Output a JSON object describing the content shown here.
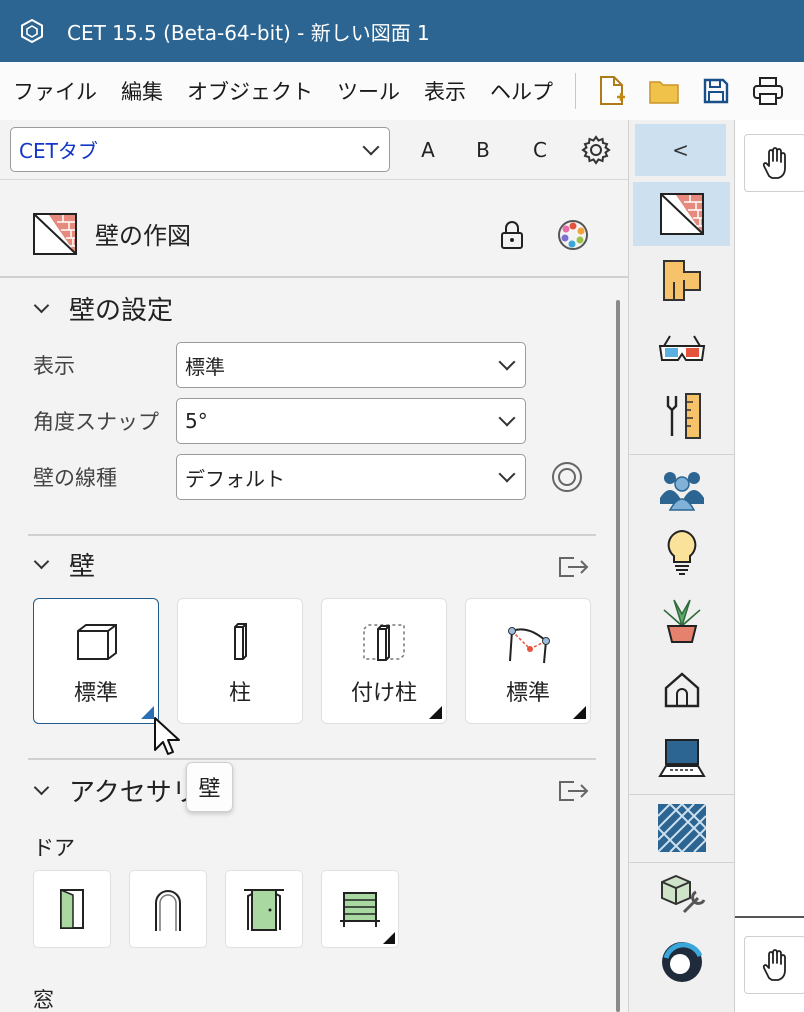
{
  "window": {
    "title": "CET 15.5 (Beta-64-bit) - 新しい図面 1"
  },
  "menu": [
    "ファイル",
    "編集",
    "オブジェクト",
    "ツール",
    "表示",
    "ヘルプ"
  ],
  "toolbar": {
    "icons": [
      "new-document-icon",
      "open-folder-icon",
      "save-icon",
      "print-icon"
    ]
  },
  "tabs": {
    "selected": "CETタブ",
    "letters": [
      "A",
      "B",
      "C"
    ],
    "collapse_glyph": "<"
  },
  "panel": {
    "title": "壁の作図"
  },
  "wall_settings": {
    "header": "壁の設定",
    "fields": [
      {
        "label": "表示",
        "value": "標準"
      },
      {
        "label": "角度スナップ",
        "value": "5°"
      },
      {
        "label": "壁の線種",
        "value": "デフォルト"
      }
    ]
  },
  "walls": {
    "header": "壁",
    "tiles": [
      {
        "label": "標準",
        "icon": "wall-block-icon",
        "selected": true
      },
      {
        "label": "柱",
        "icon": "column-icon",
        "selected": false
      },
      {
        "label": "付け柱",
        "icon": "attached-column-icon",
        "selected": false
      },
      {
        "label": "標準",
        "icon": "curved-wall-icon",
        "selected": false
      }
    ]
  },
  "accessories": {
    "header": "アクセサリ",
    "doors_label": "ドア",
    "door_icons": [
      "door-icon",
      "opening-arch-icon",
      "double-door-icon",
      "sliding-door-icon"
    ],
    "windows_label": "窓"
  },
  "tooltip": "壁",
  "side_strip": [
    "wall-drawing-icon",
    "floor-plan-icon",
    "3d-glasses-icon",
    "tools-ruler-icon",
    "people-icon",
    "lightbulb-icon",
    "plant-icon",
    "house-icon",
    "laptop-icon",
    "tile-pattern-icon",
    "cube-wrench-icon",
    "cet-logo-icon"
  ],
  "colors": {
    "titlebar": "#2c6592",
    "accent": "#1e5b8f",
    "selected_bg": "#cde0ef",
    "tab_text": "#1237c8"
  }
}
